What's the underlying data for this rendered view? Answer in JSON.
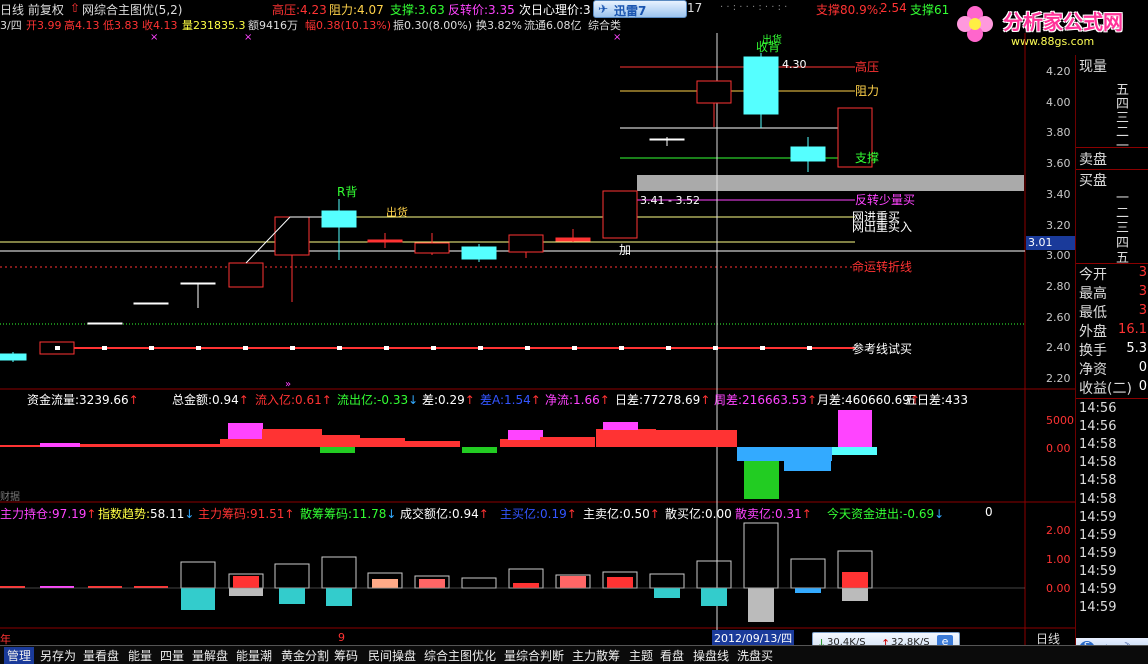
{
  "topbar": {
    "title": "日线 前复权",
    "indicator": "网综合主图优(5,2)",
    "items": [
      {
        "label": "高压:",
        "value": "4.23",
        "color": "#ff3333"
      },
      {
        "label": "阻力:",
        "value": "4.07",
        "color": "#ffd24a"
      },
      {
        "label": "支撑:",
        "value": "3.63",
        "color": "#33ff33"
      },
      {
        "label": "反转价:",
        "value": "3.35",
        "color": "#ff44ff"
      },
      {
        "label": "次日心理价:",
        "value": "3",
        "color": "#ffffff"
      }
    ],
    "download_badge": "迅雷7",
    "num17": "17",
    "right_support1": "支撑80.9%:",
    "right_support1_val": "2.54",
    "right_support2": "支撑61",
    "brand_name": "分析家公式网",
    "brand_url": "www.88gs.com"
  },
  "statline": {
    "date": "3/四",
    "open": "开3.99",
    "high": "高4.13",
    "low": "低3.83",
    "close": "收4.13",
    "volume": "量231835.3",
    "amount": "额9416万",
    "change": "幅0.38(10.13%)",
    "amplitude": "振0.30(8.00%)",
    "turnover": "换3.82%",
    "float": "流通6.08亿",
    "category": "综合类"
  },
  "price_axis": [
    "4.20",
    "4.00",
    "3.80",
    "3.60",
    "3.40",
    "3.20",
    "3.00",
    "2.80",
    "2.60",
    "2.40",
    "2.20"
  ],
  "current_price": "3.01",
  "chart_labels": {
    "gaoya": "高压",
    "zuli": "阻力",
    "zhicheng": "支撑",
    "fanzhuan": "反转少量买",
    "wangjin": "网进重买",
    "wangchi": "网出重买入",
    "mingyun": "命运转折线",
    "cankao": "参考线试买",
    "range": "3.41 - 3.52",
    "jia": "加",
    "rbei": "R背",
    "chuhuo": "出货",
    "shoubei": "收背",
    "chuhuo2": "出货",
    "v430": "4.30"
  },
  "money_header": [
    {
      "label": "资金流量:",
      "value": "3239.66",
      "arrow": "↑",
      "color": "#ffffff",
      "acolor": "#ff3333"
    },
    {
      "label": "总金额:",
      "value": "0.94",
      "arrow": "↑",
      "color": "#ffffff",
      "acolor": "#ff3333"
    },
    {
      "label": "流入亿:",
      "value": "0.61",
      "arrow": "↑",
      "color": "#ff3333",
      "acolor": "#ff3333"
    },
    {
      "label": "流出亿:",
      "value": "-0.33",
      "arrow": "↓",
      "color": "#33ff33",
      "acolor": "#33aaff"
    },
    {
      "label": "差:",
      "value": "0.29",
      "arrow": "↑",
      "color": "#ffffff",
      "acolor": "#ff3333"
    },
    {
      "label": "差A:",
      "value": "1.54",
      "arrow": "↑",
      "color": "#3355ff",
      "acolor": "#ff3333"
    },
    {
      "label": "净流:",
      "value": "1.66",
      "arrow": "↑",
      "color": "#ff44ff",
      "acolor": "#ff3333"
    },
    {
      "label": "日差:",
      "value": "77278.69",
      "arrow": "↑",
      "color": "#ffffff",
      "acolor": "#ff3333"
    },
    {
      "label": "周差:",
      "value": "216663.53",
      "arrow": "↑",
      "color": "#ff44ff",
      "acolor": "#ff3333"
    },
    {
      "label": "月差:",
      "value": "460660.69",
      "arrow": "↑",
      "color": "#ffffff",
      "acolor": "#ff3333"
    },
    {
      "label": "五日差:",
      "value": "433",
      "arrow": "",
      "color": "#ffffff",
      "acolor": "#ff3333"
    }
  ],
  "money_axis": [
    "5000",
    "0.00"
  ],
  "money_sub": "财据",
  "fund_header": [
    {
      "label": "主力持仓:",
      "value": "97.19",
      "arrow": "↑",
      "color": "#ff44ff",
      "acolor": "#ff3333"
    },
    {
      "label": "指数趋势:",
      "value": "58.11",
      "arrow": "↓",
      "color": "#ffff44",
      "acolor": "#33aaff"
    },
    {
      "label": "主力筹码:",
      "value": "91.51",
      "arrow": "↑",
      "color": "#ff3333",
      "acolor": "#ff3333"
    },
    {
      "label": "散筹筹码:",
      "value": "11.78",
      "arrow": "↓",
      "color": "#33ff33",
      "acolor": "#33aaff"
    },
    {
      "label": "成交额亿:",
      "value": "0.94",
      "arrow": "↑",
      "color": "#ffffff",
      "acolor": "#ff3333"
    },
    {
      "label": "主买亿:",
      "value": "0.19",
      "arrow": "↑",
      "color": "#3355ff",
      "acolor": "#ff3333"
    },
    {
      "label": "主卖亿:",
      "value": "0.50",
      "arrow": "↑",
      "color": "#ffffff",
      "acolor": "#ff3333"
    },
    {
      "label": "散买亿:",
      "value": "0.00",
      "arrow": "",
      "color": "#ffffff",
      "acolor": "#ff3333"
    },
    {
      "label": "散卖亿:",
      "value": "0.31",
      "arrow": "↑",
      "color": "#ff44ff",
      "acolor": "#ff3333"
    },
    {
      "label": "今天资金进出:",
      "value": "-0.69",
      "arrow": "↓",
      "color": "#33ff33",
      "acolor": "#33aaff"
    },
    {
      "label": "",
      "value": "0",
      "arrow": "",
      "color": "#ffffff",
      "acolor": "#ffffff"
    }
  ],
  "fund_axis": [
    "2.00",
    "1.00",
    "0.00"
  ],
  "bottom_axis": {
    "left": "年",
    "nine": "9",
    "cursor_date": "2012/09/13/四",
    "period": "日线"
  },
  "right_panel": {
    "xianliang": "现量",
    "asks": [
      "五",
      "四",
      "三",
      "二",
      "一"
    ],
    "maipan": "卖盘",
    "buypan": "买盘",
    "bids": [
      "一",
      "二",
      "三",
      "四",
      "五"
    ],
    "stats": [
      {
        "label": "今开",
        "value": "3"
      },
      {
        "label": "最高",
        "value": "3"
      },
      {
        "label": "最低",
        "value": "3"
      },
      {
        "label": "外盘",
        "value": "16.1"
      },
      {
        "label": "换手",
        "value": "5.3"
      },
      {
        "label": "净资",
        "value": "0"
      },
      {
        "label": "收益(二)",
        "value": "0"
      }
    ],
    "times": [
      "14:56",
      "14:56",
      "14:58",
      "14:58",
      "14:58",
      "14:58",
      "14:59",
      "14:59",
      "14:59",
      "14:59",
      "14:59",
      "14:59"
    ]
  },
  "network": {
    "down": "30.4K/S",
    "up": "32.8K/S"
  },
  "toolbar": [
    "管理",
    "另存为",
    "量看盘",
    "能量",
    "四量",
    "量解盘",
    "能量潮",
    "黄金分割",
    "筹码",
    "民间操盘",
    "综合主图优化",
    "量综合判断",
    "主力散筹",
    "主题",
    "看盘",
    "操盘线",
    "洗盘买"
  ],
  "colors": {
    "red": "#ff3333",
    "yellow": "#ffd24a",
    "green": "#33ff33",
    "magenta": "#ff44ff",
    "cyan": "#55ffff",
    "bg": "#000000"
  }
}
